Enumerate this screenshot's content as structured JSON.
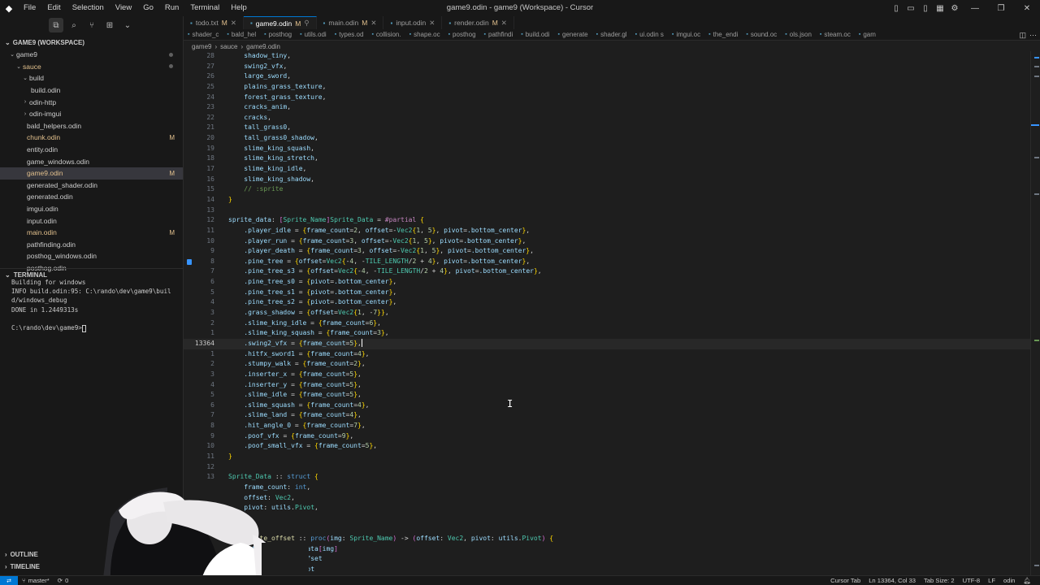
{
  "window": {
    "title": "game9.odin - game9 (Workspace) - Cursor",
    "menu": [
      "File",
      "Edit",
      "Selection",
      "View",
      "Go",
      "Run",
      "Terminal",
      "Help"
    ]
  },
  "tabs": [
    {
      "label": "todo.txt",
      "badge": "M",
      "active": false
    },
    {
      "label": "game9.odin",
      "badge": "M",
      "active": true
    },
    {
      "label": "main.odin",
      "badge": "M",
      "active": false
    },
    {
      "label": "input.odin",
      "badge": "",
      "active": false
    },
    {
      "label": "render.odin",
      "badge": "M",
      "active": false
    }
  ],
  "tabs_row2": [
    "shader_c",
    "bald_hel",
    "posthog",
    "utils.odi",
    "types.od",
    "collision.",
    "shape.oc",
    "posthog",
    "pathfindi",
    "build.odi",
    "generate",
    "shader.gl",
    "ui.odin s",
    "imgui.oc",
    "the_endi",
    "sound.oc",
    "ols.json",
    "steam.oc",
    "gam"
  ],
  "breadcrumb": [
    "game9",
    "sauce",
    "game9.odin"
  ],
  "explorer": {
    "workspace": "GAME9 (WORKSPACE)",
    "rows": [
      {
        "label": "game9",
        "chevron": "⌄",
        "indent": 10,
        "badge": "",
        "dot": true
      },
      {
        "label": "sauce",
        "chevron": "⌄",
        "indent": 18,
        "badge": "",
        "dot": true,
        "mod": true
      },
      {
        "label": "build",
        "chevron": "⌄",
        "indent": 26,
        "badge": "",
        "dot": false
      },
      {
        "label": "build.odin",
        "chevron": "",
        "indent": 38,
        "badge": "",
        "dot": false
      },
      {
        "label": "odin-http",
        "chevron": "›",
        "indent": 26,
        "badge": "",
        "dot": false
      },
      {
        "label": "odin-imgui",
        "chevron": "›",
        "indent": 26,
        "badge": "",
        "dot": false
      },
      {
        "label": "bald_helpers.odin",
        "chevron": "",
        "indent": 33,
        "badge": "",
        "dot": false
      },
      {
        "label": "chunk.odin",
        "chevron": "",
        "indent": 33,
        "badge": "M",
        "dot": false,
        "mod": true
      },
      {
        "label": "entity.odin",
        "chevron": "",
        "indent": 33,
        "badge": "",
        "dot": false
      },
      {
        "label": "game_windows.odin",
        "chevron": "",
        "indent": 33,
        "badge": "",
        "dot": false
      },
      {
        "label": "game9.odin",
        "chevron": "",
        "indent": 33,
        "badge": "M",
        "dot": false,
        "mod": true,
        "selected": true
      },
      {
        "label": "generated_shader.odin",
        "chevron": "",
        "indent": 33,
        "badge": "",
        "dot": false
      },
      {
        "label": "generated.odin",
        "chevron": "",
        "indent": 33,
        "badge": "",
        "dot": false
      },
      {
        "label": "imgui.odin",
        "chevron": "",
        "indent": 33,
        "badge": "",
        "dot": false
      },
      {
        "label": "input.odin",
        "chevron": "",
        "indent": 33,
        "badge": "",
        "dot": false
      },
      {
        "label": "main.odin",
        "chevron": "",
        "indent": 33,
        "badge": "M",
        "dot": false,
        "mod": true
      },
      {
        "label": "pathfinding.odin",
        "chevron": "",
        "indent": 33,
        "badge": "",
        "dot": false
      },
      {
        "label": "posthog_windows.odin",
        "chevron": "",
        "indent": 33,
        "badge": "",
        "dot": false
      },
      {
        "label": "posthog.odin",
        "chevron": "",
        "indent": 33,
        "badge": "",
        "dot": false
      }
    ]
  },
  "terminal": {
    "header": "TERMINAL",
    "lines": [
      "Building for windows",
      "INFO build.odin:95: C:\\rando\\dev\\game9\\buil",
      "d/windows_debug",
      "DONE in 1.2449313s",
      "",
      "C:\\rando\\dev\\game9>"
    ]
  },
  "outline_label": "OUTLINE",
  "timeline_label": "TIMELINE",
  "editor": {
    "lines": [
      {
        "n": "28",
        "code": "    shadow_tiny,"
      },
      {
        "n": "27",
        "code": "    swing2_vfx,"
      },
      {
        "n": "26",
        "code": "    large_sword,"
      },
      {
        "n": "25",
        "code": "    plains_grass_texture,"
      },
      {
        "n": "24",
        "code": "    forest_grass_texture,"
      },
      {
        "n": "23",
        "code": "    cracks_anim,"
      },
      {
        "n": "22",
        "code": "    cracks,"
      },
      {
        "n": "21",
        "code": "    tall_grass0,"
      },
      {
        "n": "20",
        "code": "    tall_grass0_shadow,"
      },
      {
        "n": "19",
        "code": "    slime_king_squash,"
      },
      {
        "n": "18",
        "code": "    slime_king_stretch,"
      },
      {
        "n": "17",
        "code": "    slime_king_idle,"
      },
      {
        "n": "16",
        "code": "    slime_king_shadow,"
      },
      {
        "n": "15",
        "code": "    // :sprite"
      },
      {
        "n": "14",
        "code": "}"
      },
      {
        "n": "13",
        "code": ""
      },
      {
        "n": "12",
        "code": "sprite_data: [Sprite_Name]Sprite_Data = #partial {"
      },
      {
        "n": "11",
        "code": "    .player_idle = {frame_count=2, offset=-Vec2{1, 5}, pivot=.bottom_center},"
      },
      {
        "n": "10",
        "code": "    .player_run = {frame_count=3, offset=-Vec2{1, 5}, pivot=.bottom_center},"
      },
      {
        "n": "9",
        "code": "    .player_death = {frame_count=3, offset=-Vec2{1, 5}, pivot=.bottom_center},"
      },
      {
        "n": "8",
        "code": "    .pine_tree = {offset=Vec2{-4, -TILE_LENGTH/2 + 4}, pivot=.bottom_center},"
      },
      {
        "n": "7",
        "code": "    .pine_tree_s3 = {offset=Vec2{-4, -TILE_LENGTH/2 + 4}, pivot=.bottom_center},"
      },
      {
        "n": "6",
        "code": "    .pine_tree_s0 = {pivot=.bottom_center},"
      },
      {
        "n": "5",
        "code": "    .pine_tree_s1 = {pivot=.bottom_center},"
      },
      {
        "n": "4",
        "code": "    .pine_tree_s2 = {pivot=.bottom_center},"
      },
      {
        "n": "3",
        "code": "    .grass_shadow = {offset=Vec2{1, -7}},"
      },
      {
        "n": "2",
        "code": "    .slime_king_idle = {frame_count=6},"
      },
      {
        "n": "1",
        "code": "    .slime_king_squash = {frame_count=3},"
      },
      {
        "n": "13364",
        "code": "    .swing2_vfx = {frame_count=5},",
        "current": true
      },
      {
        "n": "1",
        "code": "    .hitfx_sword1 = {frame_count=4},"
      },
      {
        "n": "2",
        "code": "    .stumpy_walk = {frame_count=2},"
      },
      {
        "n": "3",
        "code": "    .inserter_x = {frame_count=5},"
      },
      {
        "n": "4",
        "code": "    .inserter_y = {frame_count=5},"
      },
      {
        "n": "5",
        "code": "    .slime_idle = {frame_count=5},"
      },
      {
        "n": "6",
        "code": "    .slime_squash = {frame_count=4},"
      },
      {
        "n": "7",
        "code": "    .slime_land = {frame_count=4},"
      },
      {
        "n": "8",
        "code": "    .hit_angle_0 = {frame_count=7},"
      },
      {
        "n": "9",
        "code": "    .poof_vfx = {frame_count=9},"
      },
      {
        "n": "10",
        "code": "    .poof_small_vfx = {frame_count=5},"
      },
      {
        "n": "11",
        "code": "}"
      },
      {
        "n": "12",
        "code": ""
      },
      {
        "n": "13",
        "code": "Sprite_Data :: struct {"
      },
      {
        "n": "",
        "code": "    frame_count: int,"
      },
      {
        "n": "",
        "code": "    offset: Vec2,"
      },
      {
        "n": "",
        "code": "    pivot: utils.Pivot,"
      },
      {
        "n": "",
        "code": "}"
      },
      {
        "n": "",
        "code": ""
      },
      {
        "n": "",
        "code": "get_sprite_offset :: proc(img: Sprite_Name) -> (offset: Vec2, pivot: utils.Pivot) {"
      },
      {
        "n": "",
        "code": "    data := sprite_data[img]"
      },
      {
        "n": "",
        "code": "    offset = data.offset"
      },
      {
        "n": "",
        "code": "    pivot = data.pivot"
      }
    ]
  },
  "statusbar": {
    "branch": "master*",
    "sync": "0",
    "cursor_tab": "Cursor Tab",
    "position": "Ln 13364, Col 33",
    "tab_size": "Tab Size: 2",
    "encoding": "UTF-8",
    "eol": "LF",
    "language": "odin"
  },
  "colors": {
    "accent": "#0078d4",
    "modified": "#e2c08d",
    "background": "#1e1e1e",
    "sidebar": "#181818"
  }
}
